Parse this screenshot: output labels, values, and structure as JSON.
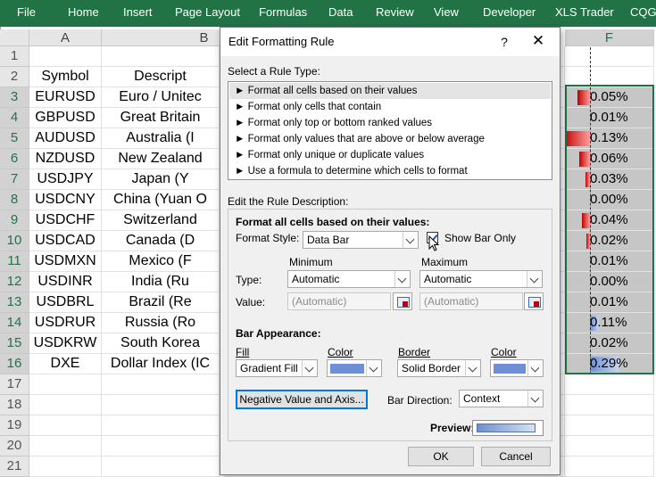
{
  "ribbon": {
    "tabs": [
      "File",
      "Home",
      "Insert",
      "Page Layout",
      "Formulas",
      "Data",
      "Review",
      "View",
      "Developer",
      "XLS Trader",
      "CQG"
    ]
  },
  "sheet": {
    "columns": [
      "A",
      "B",
      "F"
    ],
    "row_numbers": [
      "1",
      "2",
      "3",
      "4",
      "5",
      "6",
      "7",
      "8",
      "9",
      "10",
      "11",
      "12",
      "13",
      "14",
      "15",
      "16",
      "17",
      "18",
      "19",
      "20",
      "21"
    ],
    "col_a": [
      "",
      "Symbol",
      "EURUSD",
      "GBPUSD",
      "AUDUSD",
      "NZDUSD",
      "USDJPY",
      "USDCNY",
      "USDCHF",
      "USDCAD",
      "USDMXN",
      "USDINR",
      "USDBRL",
      "USDRUR",
      "USDKRW",
      "DXE"
    ],
    "col_b": [
      "",
      "Descript",
      "Euro / Unitec",
      "Great Britain",
      "Australia (I",
      "New Zealand",
      "Japan (Y",
      "China (Yuan O",
      "Switzerland",
      "Canada (D",
      "Mexico (F",
      "India (Ru",
      "Brazil (Re",
      "Russia (Ro",
      "South Korea",
      "Dollar Index (IC"
    ],
    "col_f": [
      "0.05%",
      "0.01%",
      "0.13%",
      "0.06%",
      "0.03%",
      "0.00%",
      "0.04%",
      "0.02%",
      "0.01%",
      "0.00%",
      "0.01%",
      "0.11%",
      "0.02%",
      "0.29%"
    ]
  },
  "dialog": {
    "title": "Edit Formatting Rule",
    "help": "?",
    "close": "✕",
    "select_rule_type_label": "Select a Rule Type:",
    "rule_types": [
      "► Format all cells based on their values",
      "► Format only cells that contain",
      "► Format only top or bottom ranked values",
      "► Format only values that are above or below average",
      "► Format only unique or duplicate values",
      "► Use a formula to determine which cells to format"
    ],
    "edit_desc_label": "Edit the Rule Description:",
    "format_all_label": "Format all cells based on their values:",
    "format_style_label": "Format Style:",
    "format_style_value": "Data Bar",
    "show_bar_only": "Show Bar Only",
    "minimum_label": "Minimum",
    "maximum_label": "Maximum",
    "type_label": "Type:",
    "value_label": "Value:",
    "min_type": "Automatic",
    "max_type": "Automatic",
    "min_value": "(Automatic)",
    "max_value": "(Automatic)",
    "bar_appearance_label": "Bar Appearance:",
    "fill_label": "Fill",
    "color_label": "Color",
    "border_label": "Border",
    "color2_label": "Color",
    "fill_value": "Gradient Fill",
    "border_value": "Solid Border",
    "negative_button": "Negative Value and Axis...",
    "bar_direction_label": "Bar Direction:",
    "bar_direction_value": "Context",
    "preview_label": "Preview:",
    "ok": "OK",
    "cancel": "Cancel"
  },
  "colors": {
    "ribbon": "#217346",
    "bar_color": "#6e8fd3",
    "negative_bar": "#c00000"
  }
}
